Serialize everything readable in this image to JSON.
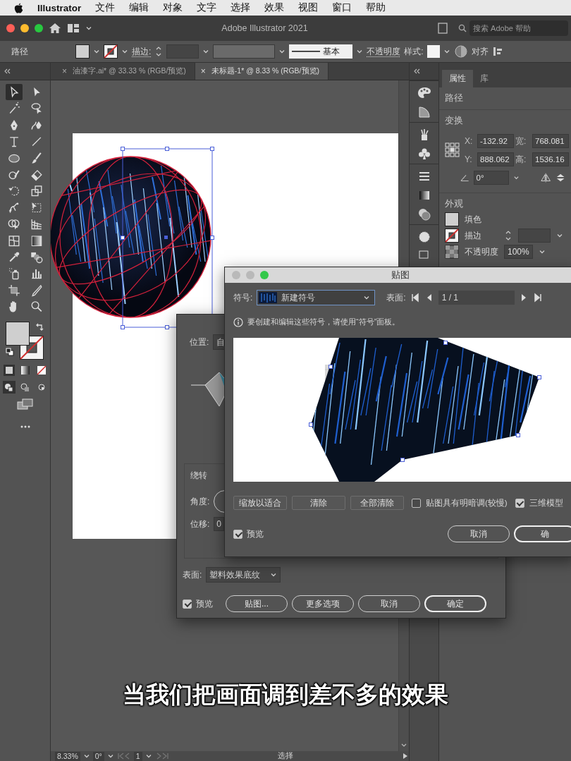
{
  "menu_bar": {
    "app": "Illustrator",
    "items": [
      "文件",
      "编辑",
      "对象",
      "文字",
      "选择",
      "效果",
      "视图",
      "窗口",
      "帮助"
    ]
  },
  "title_bar": {
    "title": "Adobe Illustrator 2021",
    "search": {
      "placeholder": "搜索 Adobe 帮助"
    }
  },
  "control_bar": {
    "object_type": "路径",
    "stroke_label": "描边:",
    "stroke_profile": "基本",
    "opacity_label": "不透明度",
    "style_label": "样式:",
    "align_label": "对齐"
  },
  "document_tabs": [
    {
      "close": "×",
      "label": "油漆字.ai* @ 33.33 % (RGB/预览)",
      "selected": false
    },
    {
      "close": "×",
      "label": "未标题-1* @ 8.33 % (RGB/预览)",
      "selected": true
    }
  ],
  "toolbar": {
    "tools": [
      {
        "kind": "selection",
        "selected": true
      },
      {
        "kind": "direct-selection",
        "selected": false
      },
      {
        "kind": "magic-wand",
        "selected": false
      },
      {
        "kind": "lasso",
        "selected": false
      },
      {
        "kind": "pen",
        "selected": false
      },
      {
        "kind": "curvature",
        "selected": false
      },
      {
        "kind": "type",
        "selected": false
      },
      {
        "kind": "line",
        "selected": false
      },
      {
        "kind": "ellipse",
        "selected": false
      },
      {
        "kind": "brush",
        "selected": false
      },
      {
        "kind": "shaper",
        "selected": false
      },
      {
        "kind": "eraser",
        "selected": false
      },
      {
        "kind": "rotate",
        "selected": false
      },
      {
        "kind": "scale",
        "selected": false
      },
      {
        "kind": "puppet",
        "selected": false
      },
      {
        "kind": "free-transform",
        "selected": false
      },
      {
        "kind": "shape-builder",
        "selected": false
      },
      {
        "kind": "perspective",
        "selected": false
      },
      {
        "kind": "mesh",
        "selected": false
      },
      {
        "kind": "gradient",
        "selected": false
      },
      {
        "kind": "eyedropper",
        "selected": false
      },
      {
        "kind": "blend",
        "selected": false
      },
      {
        "kind": "symbol-sprayer",
        "selected": false
      },
      {
        "kind": "graph",
        "selected": false
      },
      {
        "kind": "artboard",
        "selected": false
      },
      {
        "kind": "slice",
        "selected": false
      },
      {
        "kind": "hand",
        "selected": false
      },
      {
        "kind": "zoom",
        "selected": false
      }
    ]
  },
  "status_bar": {
    "zoom": "8.33%",
    "rotation": "0°",
    "artboard": "1",
    "tool": "选择"
  },
  "properties_panel": {
    "tabs": [
      {
        "label": "属性",
        "selected": true
      },
      {
        "label": "库",
        "selected": false
      }
    ],
    "object_type": "路径",
    "transform": {
      "title": "变换",
      "fields": [
        {
          "label": "X:",
          "value": "-132.92"
        },
        {
          "label": "宽:",
          "value": "768.081"
        },
        {
          "label": "Y:",
          "value": "888.062"
        },
        {
          "label": "高:",
          "value": "1536.16"
        }
      ],
      "angle": "0°"
    },
    "appearance": {
      "title": "外观",
      "rows": [
        {
          "kind": "fill",
          "label": "填色"
        },
        {
          "kind": "stroke",
          "label": "描边"
        },
        {
          "kind": "opacity",
          "label": "不透明度",
          "value": "100%"
        }
      ]
    }
  },
  "dialog_3d": {
    "position_label": "位置:",
    "position_value": "自",
    "revolve_title": "绕转",
    "angle_label": "角度:",
    "offset_label": "位移:",
    "offset_value": "0",
    "surface_label": "表面:",
    "surface_value": "塑料效果底纹",
    "preview": {
      "label": "预览",
      "checked": true
    },
    "buttons": [
      {
        "label": "贴图...",
        "default": false
      },
      {
        "label": "更多选项",
        "default": false
      },
      {
        "label": "取消",
        "default": false
      },
      {
        "label": "确定",
        "default": true
      }
    ]
  },
  "map_art_dialog": {
    "title": "贴图",
    "symbol_label": "符号:",
    "symbol_value": "新建符号",
    "surface_label": "表面:",
    "surface_page": "1 / 1",
    "info": "要创建和编辑这些符号，请使用“符号”面板。",
    "buttons": [
      "缩放以适合",
      "清除",
      "全部清除"
    ],
    "options": [
      {
        "label": "贴图具有明暗调(较慢)",
        "checked": false
      },
      {
        "label": "三维模型",
        "checked": true
      }
    ],
    "preview": {
      "label": "预览",
      "checked": true
    },
    "footer_buttons": [
      {
        "label": "取消",
        "default": false
      },
      {
        "label": "确",
        "default": true
      }
    ]
  },
  "subtitle": "当我们把画面调到差不多的效果"
}
